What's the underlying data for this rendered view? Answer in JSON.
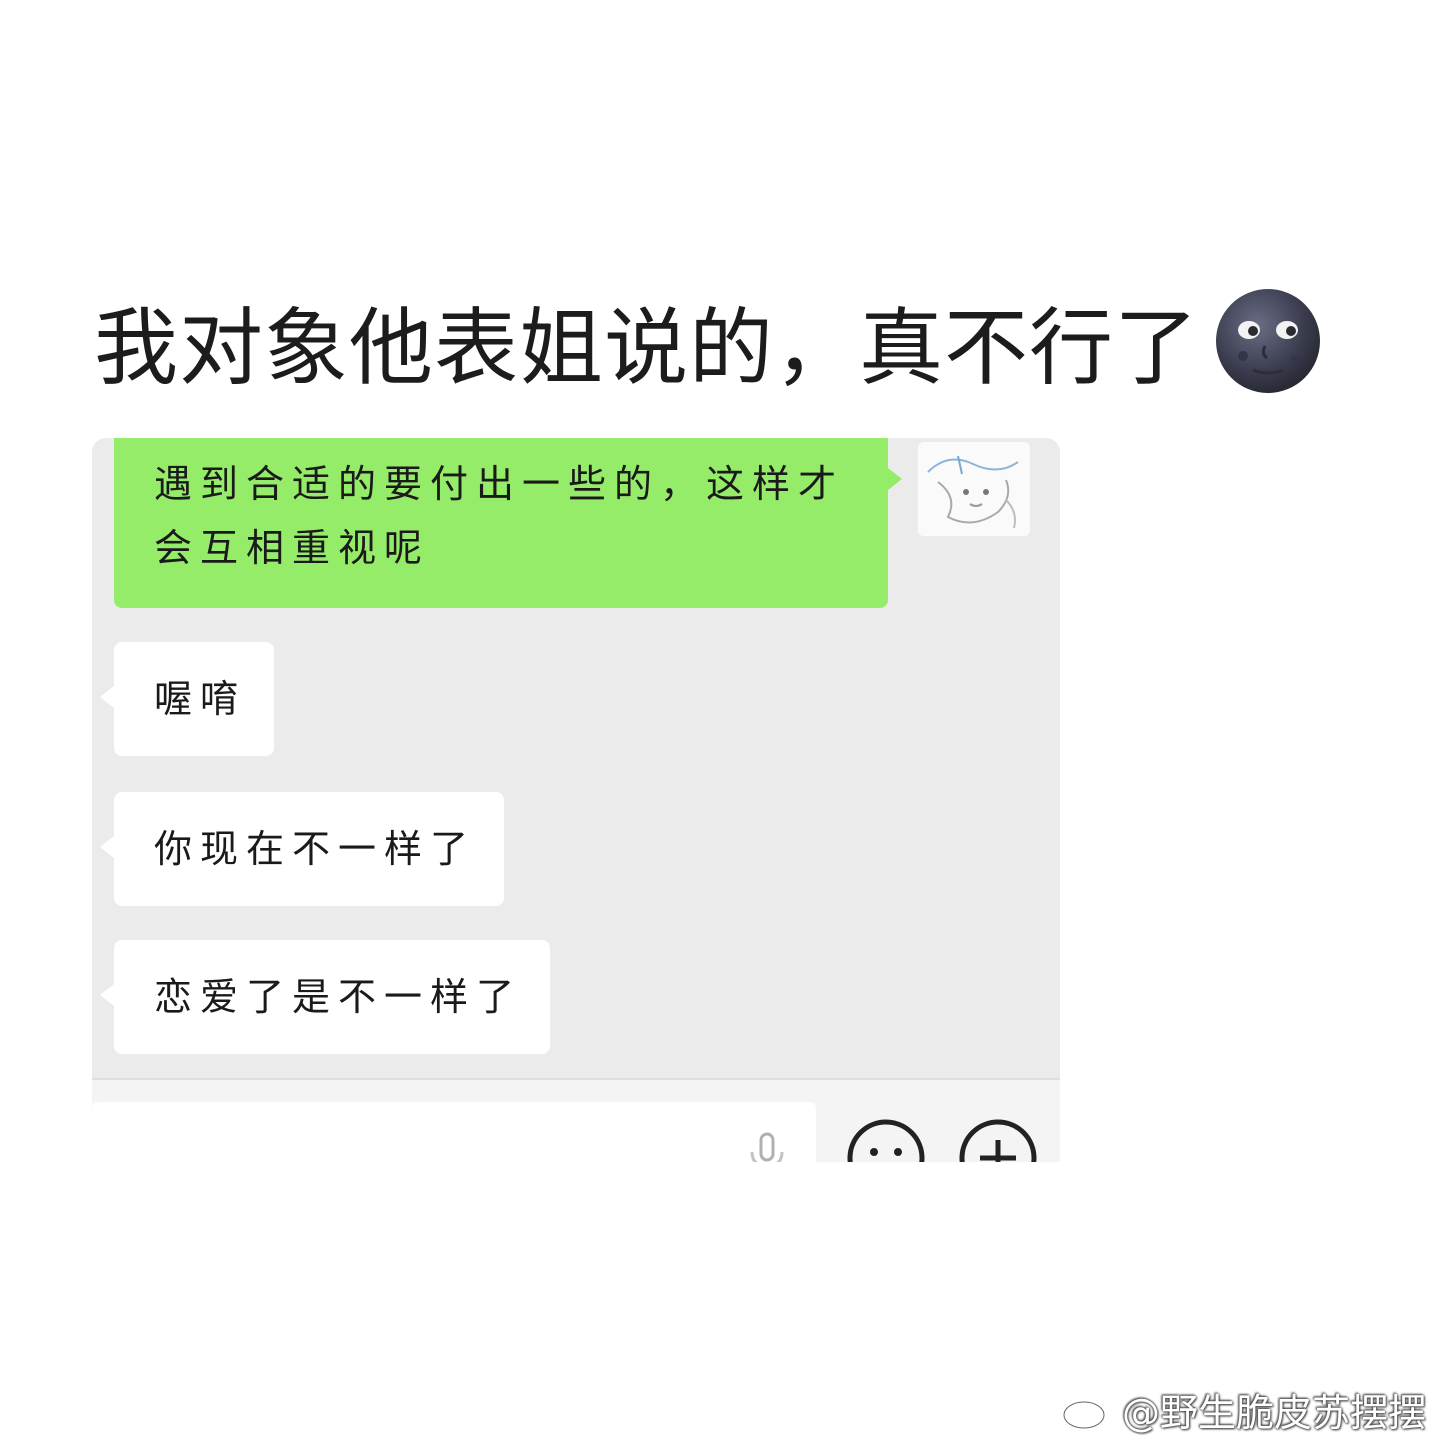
{
  "caption": {
    "text": "我对象他表姐说的，真不行了",
    "emoji_icon": "new-moon-face-icon"
  },
  "chat": {
    "messages": [
      {
        "side": "sent",
        "text": "遇到合适的要付出一些的，这样才会互相重视呢"
      },
      {
        "side": "received",
        "text": "喔唷"
      },
      {
        "side": "received",
        "text": "你现在不一样了"
      },
      {
        "side": "received",
        "text": "恋爱了是不一样了"
      }
    ],
    "sent_avatar_icon": "cartoon-sketch-avatar-icon",
    "bubble_colors": {
      "sent": "#95ec69",
      "received": "#ffffff",
      "background": "#ebebeb"
    },
    "input_bar": {
      "icons": [
        "microphone-icon",
        "smiley-icon",
        "plus-circle-icon"
      ]
    }
  },
  "watermark": {
    "text": "@野生脆皮苏摆摆",
    "icon": "weibo-logo-icon"
  }
}
